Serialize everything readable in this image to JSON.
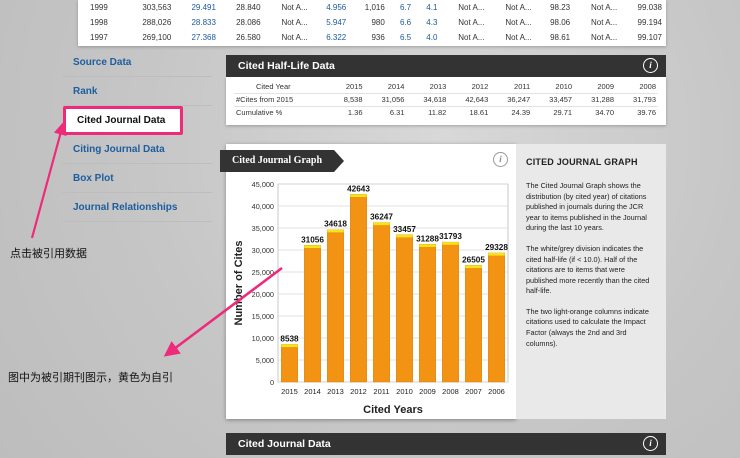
{
  "top_table": {
    "rows": [
      [
        "1999",
        "303,563",
        "29.491",
        "28.840",
        "Not A...",
        "4.956",
        "1,016",
        "6.7",
        "4.1",
        "Not A...",
        "Not A...",
        "98.23",
        "Not A...",
        "99.038"
      ],
      [
        "1998",
        "288,026",
        "28.833",
        "28.086",
        "Not A...",
        "5.947",
        "980",
        "6.6",
        "4.3",
        "Not A...",
        "Not A...",
        "98.06",
        "Not A...",
        "99.194"
      ],
      [
        "1997",
        "269,100",
        "27.368",
        "26.580",
        "Not A...",
        "6.322",
        "936",
        "6.5",
        "4.0",
        "Not A...",
        "Not A...",
        "98.61",
        "Not A...",
        "99.107"
      ]
    ]
  },
  "sidebar": {
    "items": [
      {
        "label": "Source Data"
      },
      {
        "label": "Rank"
      },
      {
        "label": "Cited Journal Data"
      },
      {
        "label": "Citing Journal Data"
      },
      {
        "label": "Box Plot"
      },
      {
        "label": "Journal Relationships"
      }
    ]
  },
  "halflife": {
    "title": "Cited Half-Life Data",
    "info": "i",
    "header": [
      "Cited Year",
      "2015",
      "2014",
      "2013",
      "2012",
      "2011",
      "2010",
      "2009",
      "2008"
    ],
    "rows": [
      [
        "#Cites from 2015",
        "8,538",
        "31,056",
        "34,618",
        "42,643",
        "36,247",
        "33,457",
        "31,288",
        "31,793"
      ],
      [
        "Cumulative %",
        "1.36",
        "6.31",
        "11.82",
        "18.61",
        "24.39",
        "29.71",
        "34.70",
        "39.76"
      ]
    ]
  },
  "graph": {
    "tab_title": "Cited Journal Graph",
    "info": "i"
  },
  "chart_data": {
    "type": "bar",
    "categories": [
      "2015",
      "2014",
      "2013",
      "2012",
      "2011",
      "2010",
      "2009",
      "2008",
      "2007",
      "2006"
    ],
    "values": [
      8538,
      31056,
      34618,
      42643,
      36247,
      33457,
      31288,
      31793,
      26505,
      29328
    ],
    "value_labels": [
      "8538",
      "31056",
      "34618",
      "42643",
      "36247",
      "33457",
      "31288",
      "31793",
      "26505",
      "29328"
    ],
    "self_cite_portion": [
      600,
      600,
      600,
      600,
      600,
      600,
      600,
      600,
      600,
      600
    ],
    "xlabel": "Cited Years",
    "ylabel": "Number of Cites",
    "ylim": [
      0,
      45000
    ],
    "yticks": [
      "0",
      "5,000",
      "10,000",
      "15,000",
      "20,000",
      "25,000",
      "30,000",
      "35,000",
      "40,000",
      "45,000"
    ],
    "ytick_values": [
      0,
      5000,
      10000,
      15000,
      20000,
      25000,
      30000,
      35000,
      40000,
      45000
    ],
    "colors": {
      "bar": "#f39314",
      "self": "#f5e619",
      "highlight": "#f6a93c"
    },
    "grid": true
  },
  "description": {
    "title": "CITED JOURNAL GRAPH",
    "paragraphs": [
      "The Cited Journal Graph shows the distribution (by cited year) of citations published in journals during the JCR year to items published in the Journal during the last 10 years.",
      "The white/grey division indicates the cited half-life (if < 10.0). Half of the citations are to items that were published more recently than the cited half-life.",
      "The two light-orange columns indicate citations used to calculate the Impact Factor (always the 2nd and 3rd columns)."
    ]
  },
  "cited_panel": {
    "title": "Cited Journal Data",
    "info": "i"
  },
  "annotations": {
    "note1": "点击被引用数据",
    "note2": "图中为被引期刊图示，黄色为自引"
  },
  "colors": {
    "accent_pink": "#ee2a7b",
    "header_dark": "#333333",
    "link_blue": "#1d5d9e"
  }
}
